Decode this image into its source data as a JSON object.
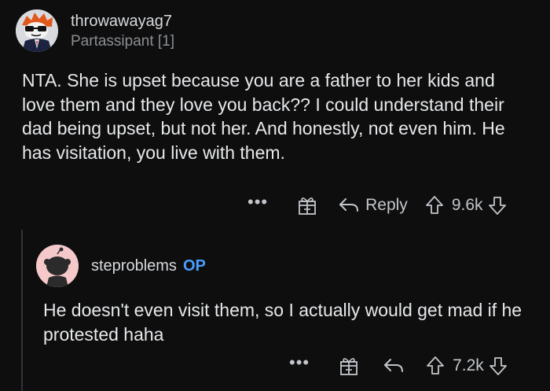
{
  "comment1": {
    "username": "throwawayag7",
    "flair": "Partassipant [1]",
    "body": "NTA. She is upset because you are a father to her kids and love them and they love you back?? I could understand their dad being upset, but not her. And honestly, not even him. He has visitation, you live with them.",
    "actions": {
      "more": "•••",
      "award_icon": "gift-icon",
      "reply_label": "Reply",
      "vote_count": "9.6k"
    }
  },
  "comment2": {
    "username": "steproblems",
    "op_badge": "OP",
    "body": "He doesn't even visit them, so I actually would get mad if he protested haha",
    "actions": {
      "more": "•••",
      "award_icon": "gift-icon",
      "vote_count": "7.2k"
    }
  },
  "colors": {
    "background": "#0e0e0f",
    "op_badge": "#4a9eff",
    "text": "#e6e8ea",
    "muted": "#8b8f93"
  }
}
